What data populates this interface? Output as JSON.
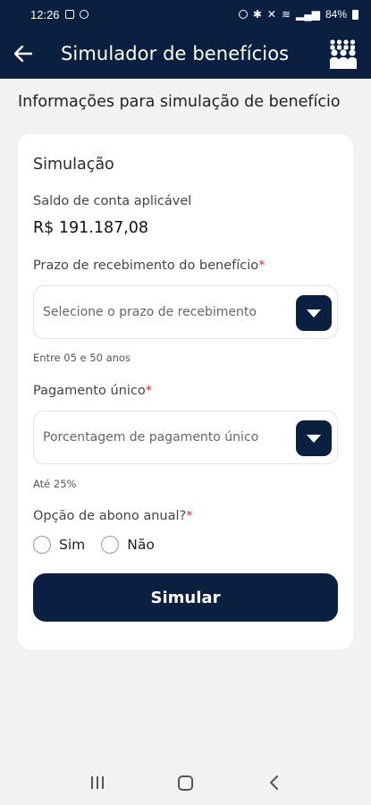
{
  "status_bar": {
    "time": "12:26",
    "battery": "84%"
  },
  "app_bar": {
    "title": "Simulador de benefícios"
  },
  "page": {
    "heading": "Informações para simulação de benefício"
  },
  "card": {
    "title": "Simulação",
    "balance_label": "Saldo de conta aplicável",
    "balance_value": "R$ 191.187,08",
    "term": {
      "label": "Prazo de recebimento do benefício",
      "required_mark": "*",
      "placeholder": "Selecione o prazo de recebimento",
      "hint": "Entre 05 e 50 anos"
    },
    "single_payment": {
      "label": "Pagamento único",
      "required_mark": "*",
      "placeholder": "Porcentagem de pagamento único",
      "hint": "Até 25%"
    },
    "annual_bonus": {
      "label": "Opção de abono anual?",
      "required_mark": "*",
      "options": [
        "Sim",
        "Não"
      ]
    },
    "submit_label": "Simular"
  },
  "colors": {
    "primary": "#0b1f40",
    "required": "#d32f2f",
    "background": "#f2f2f2"
  },
  "icons": [
    "back-arrow-icon",
    "people-group-icon",
    "chevron-down-icon",
    "recents-icon",
    "home-icon",
    "back-icon"
  ]
}
